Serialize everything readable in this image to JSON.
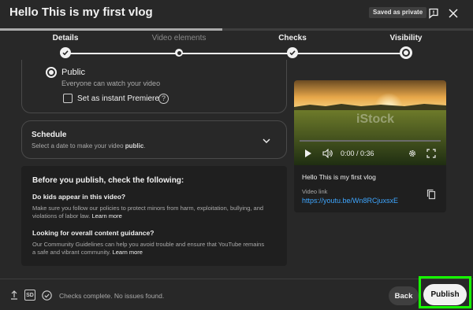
{
  "header": {
    "title": "Hello This is my first vlog",
    "saved_badge": "Saved as private"
  },
  "upload_progress": 0.47,
  "stepper": {
    "steps": [
      {
        "label": "Details",
        "state": "complete"
      },
      {
        "label": "Video elements",
        "state": "inactive"
      },
      {
        "label": "Checks",
        "state": "complete"
      },
      {
        "label": "Visibility",
        "state": "current"
      }
    ]
  },
  "visibility": {
    "public_label": "Public",
    "public_description": "Everyone can watch your video",
    "public_selected": true,
    "premiere_label": "Set as instant Premiere",
    "premiere_checked": false,
    "help_glyph": "?"
  },
  "schedule": {
    "title": "Schedule",
    "subtitle_prefix": "Select a date to make your video ",
    "subtitle_bold": "public",
    "subtitle_suffix": "."
  },
  "checklist": {
    "title": "Before you publish, check the following:",
    "items": [
      {
        "question": "Do kids appear in this video?",
        "text": "Make sure you follow our policies to protect minors from harm, exploitation, bullying, and violations of labor law. ",
        "link": "Learn more"
      },
      {
        "question": "Looking for overall content guidance?",
        "text": "Our Community Guidelines can help you avoid trouble and ensure that YouTube remains a safe and vibrant community. ",
        "link": "Learn more"
      }
    ]
  },
  "video": {
    "time": "0:00 / 0:36",
    "watermark": "iStock",
    "title": "Hello This is my first vlog",
    "link_label": "Video link",
    "link_url": "https://youtu.be/Wn8RCjuxsxE"
  },
  "footer": {
    "hd_badge": "SD",
    "status": "Checks complete. No issues found.",
    "back_label": "Back",
    "publish_label": "Publish"
  },
  "colors": {
    "background": "#282828",
    "link": "#3ea6ff",
    "highlight": "#16ff00"
  }
}
